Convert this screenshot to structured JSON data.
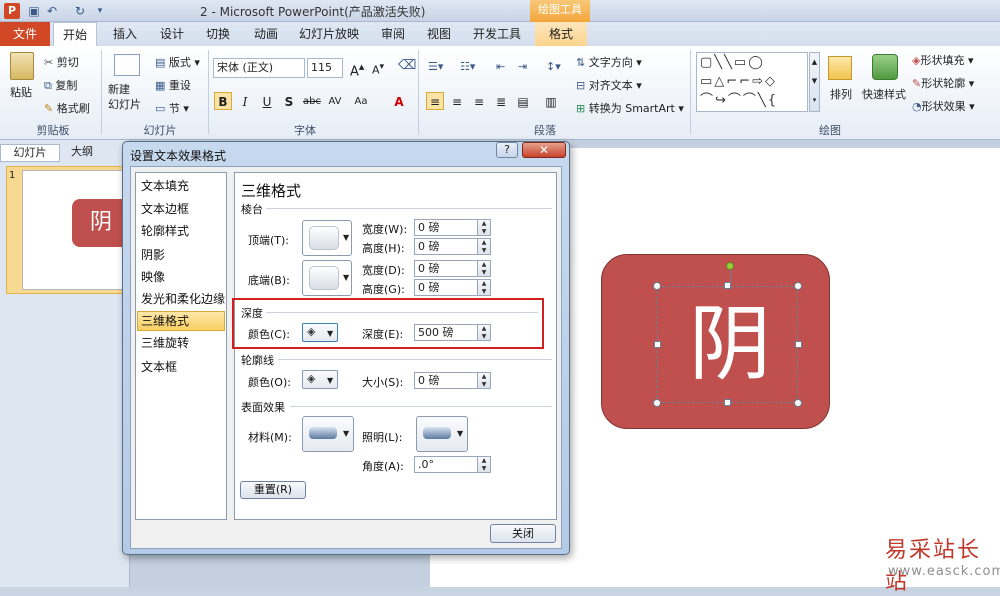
{
  "window": {
    "title": "2 - Microsoft PowerPoint(产品激活失败)",
    "app_icon": "P",
    "context_tab_group": "绘图工具"
  },
  "ribbon_tabs": [
    "文件",
    "开始",
    "插入",
    "设计",
    "切换",
    "动画",
    "幻灯片放映",
    "审阅",
    "视图",
    "开发工具",
    "格式"
  ],
  "clipboard": {
    "paste": "粘贴",
    "cut": "剪切",
    "copy": "复制",
    "format_painter": "格式刷",
    "label": "剪贴板"
  },
  "slides_group": {
    "new_slide": "新建\n幻灯片",
    "layout": "版式",
    "reset": "重设",
    "section": "节",
    "label": "幻灯片"
  },
  "font_group": {
    "font_name": "宋体 (正文)",
    "font_size": "115",
    "label": "字体"
  },
  "paragraph_group": {
    "text_direction": "文字方向",
    "align_text": "对齐文本",
    "smartart": "转换为 SmartArt",
    "label": "段落"
  },
  "drawing_group": {
    "arrange": "排列",
    "quick_styles": "快速样式",
    "shape_fill": "形状填充",
    "shape_outline": "形状轮廓",
    "shape_effects": "形状效果",
    "label": "绘图"
  },
  "panel_tabs": {
    "slides": "幻灯片",
    "outline": "大纲"
  },
  "thumbnail": {
    "number": "1",
    "text": "阴"
  },
  "slide": {
    "shape_text": "阴",
    "shape_color": "#c0504d"
  },
  "dialog": {
    "title": "设置文本效果格式",
    "help": "?",
    "close_x": "✕",
    "nav": [
      "文本填充",
      "文本边框",
      "轮廓样式",
      "阴影",
      "映像",
      "发光和柔化边缘",
      "三维格式",
      "三维旋转",
      "文本框"
    ],
    "active_nav": "三维格式",
    "heading": "三维格式",
    "bevel": {
      "section": "棱台",
      "top_label": "顶端(T):",
      "bottom_label": "底端(B):",
      "width_label": "宽度(W):",
      "height_label": "高度(H):",
      "width2_label": "宽度(D):",
      "height2_label": "高度(G):",
      "top_width": "0 磅",
      "top_height": "0 磅",
      "bottom_width": "0 磅",
      "bottom_height": "0 磅"
    },
    "depth": {
      "section": "深度",
      "color_label": "颜色(C):",
      "depth_label": "深度(E):",
      "depth_value": "500 磅"
    },
    "contour": {
      "section": "轮廓线",
      "color_label": "颜色(O):",
      "size_label": "大小(S):",
      "size_value": "0 磅"
    },
    "surface": {
      "section": "表面效果",
      "material_label": "材料(M):",
      "lighting_label": "照明(L):",
      "angle_label": "角度(A):",
      "angle_value": ".0°"
    },
    "reset_button": "重置(R)",
    "close_button": "关闭"
  },
  "watermark": {
    "text": "易采站长站",
    "url": "www.easck.com"
  }
}
